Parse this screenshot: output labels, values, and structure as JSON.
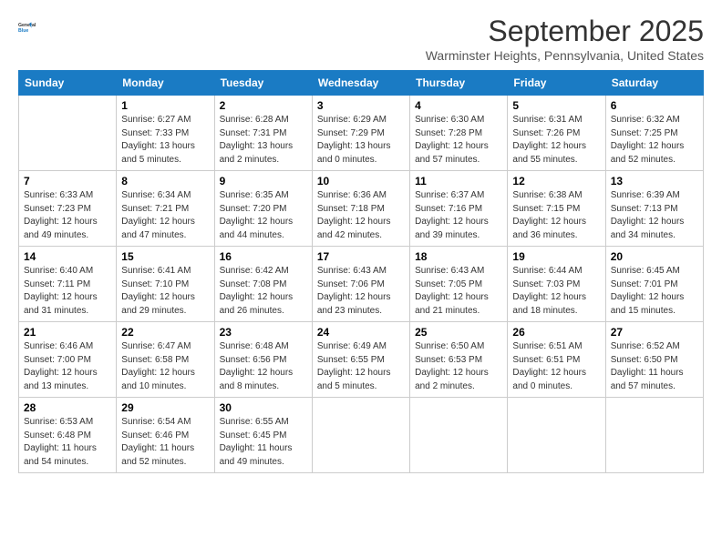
{
  "logo": {
    "line1": "General",
    "line2": "Blue"
  },
  "title": "September 2025",
  "subtitle": "Warminster Heights, Pennsylvania, United States",
  "days_of_week": [
    "Sunday",
    "Monday",
    "Tuesday",
    "Wednesday",
    "Thursday",
    "Friday",
    "Saturday"
  ],
  "weeks": [
    [
      {
        "num": "",
        "info": ""
      },
      {
        "num": "1",
        "info": "Sunrise: 6:27 AM\nSunset: 7:33 PM\nDaylight: 13 hours\nand 5 minutes."
      },
      {
        "num": "2",
        "info": "Sunrise: 6:28 AM\nSunset: 7:31 PM\nDaylight: 13 hours\nand 2 minutes."
      },
      {
        "num": "3",
        "info": "Sunrise: 6:29 AM\nSunset: 7:29 PM\nDaylight: 13 hours\nand 0 minutes."
      },
      {
        "num": "4",
        "info": "Sunrise: 6:30 AM\nSunset: 7:28 PM\nDaylight: 12 hours\nand 57 minutes."
      },
      {
        "num": "5",
        "info": "Sunrise: 6:31 AM\nSunset: 7:26 PM\nDaylight: 12 hours\nand 55 minutes."
      },
      {
        "num": "6",
        "info": "Sunrise: 6:32 AM\nSunset: 7:25 PM\nDaylight: 12 hours\nand 52 minutes."
      }
    ],
    [
      {
        "num": "7",
        "info": "Sunrise: 6:33 AM\nSunset: 7:23 PM\nDaylight: 12 hours\nand 49 minutes."
      },
      {
        "num": "8",
        "info": "Sunrise: 6:34 AM\nSunset: 7:21 PM\nDaylight: 12 hours\nand 47 minutes."
      },
      {
        "num": "9",
        "info": "Sunrise: 6:35 AM\nSunset: 7:20 PM\nDaylight: 12 hours\nand 44 minutes."
      },
      {
        "num": "10",
        "info": "Sunrise: 6:36 AM\nSunset: 7:18 PM\nDaylight: 12 hours\nand 42 minutes."
      },
      {
        "num": "11",
        "info": "Sunrise: 6:37 AM\nSunset: 7:16 PM\nDaylight: 12 hours\nand 39 minutes."
      },
      {
        "num": "12",
        "info": "Sunrise: 6:38 AM\nSunset: 7:15 PM\nDaylight: 12 hours\nand 36 minutes."
      },
      {
        "num": "13",
        "info": "Sunrise: 6:39 AM\nSunset: 7:13 PM\nDaylight: 12 hours\nand 34 minutes."
      }
    ],
    [
      {
        "num": "14",
        "info": "Sunrise: 6:40 AM\nSunset: 7:11 PM\nDaylight: 12 hours\nand 31 minutes."
      },
      {
        "num": "15",
        "info": "Sunrise: 6:41 AM\nSunset: 7:10 PM\nDaylight: 12 hours\nand 29 minutes."
      },
      {
        "num": "16",
        "info": "Sunrise: 6:42 AM\nSunset: 7:08 PM\nDaylight: 12 hours\nand 26 minutes."
      },
      {
        "num": "17",
        "info": "Sunrise: 6:43 AM\nSunset: 7:06 PM\nDaylight: 12 hours\nand 23 minutes."
      },
      {
        "num": "18",
        "info": "Sunrise: 6:43 AM\nSunset: 7:05 PM\nDaylight: 12 hours\nand 21 minutes."
      },
      {
        "num": "19",
        "info": "Sunrise: 6:44 AM\nSunset: 7:03 PM\nDaylight: 12 hours\nand 18 minutes."
      },
      {
        "num": "20",
        "info": "Sunrise: 6:45 AM\nSunset: 7:01 PM\nDaylight: 12 hours\nand 15 minutes."
      }
    ],
    [
      {
        "num": "21",
        "info": "Sunrise: 6:46 AM\nSunset: 7:00 PM\nDaylight: 12 hours\nand 13 minutes."
      },
      {
        "num": "22",
        "info": "Sunrise: 6:47 AM\nSunset: 6:58 PM\nDaylight: 12 hours\nand 10 minutes."
      },
      {
        "num": "23",
        "info": "Sunrise: 6:48 AM\nSunset: 6:56 PM\nDaylight: 12 hours\nand 8 minutes."
      },
      {
        "num": "24",
        "info": "Sunrise: 6:49 AM\nSunset: 6:55 PM\nDaylight: 12 hours\nand 5 minutes."
      },
      {
        "num": "25",
        "info": "Sunrise: 6:50 AM\nSunset: 6:53 PM\nDaylight: 12 hours\nand 2 minutes."
      },
      {
        "num": "26",
        "info": "Sunrise: 6:51 AM\nSunset: 6:51 PM\nDaylight: 12 hours\nand 0 minutes."
      },
      {
        "num": "27",
        "info": "Sunrise: 6:52 AM\nSunset: 6:50 PM\nDaylight: 11 hours\nand 57 minutes."
      }
    ],
    [
      {
        "num": "28",
        "info": "Sunrise: 6:53 AM\nSunset: 6:48 PM\nDaylight: 11 hours\nand 54 minutes."
      },
      {
        "num": "29",
        "info": "Sunrise: 6:54 AM\nSunset: 6:46 PM\nDaylight: 11 hours\nand 52 minutes."
      },
      {
        "num": "30",
        "info": "Sunrise: 6:55 AM\nSunset: 6:45 PM\nDaylight: 11 hours\nand 49 minutes."
      },
      {
        "num": "",
        "info": ""
      },
      {
        "num": "",
        "info": ""
      },
      {
        "num": "",
        "info": ""
      },
      {
        "num": "",
        "info": ""
      }
    ]
  ]
}
